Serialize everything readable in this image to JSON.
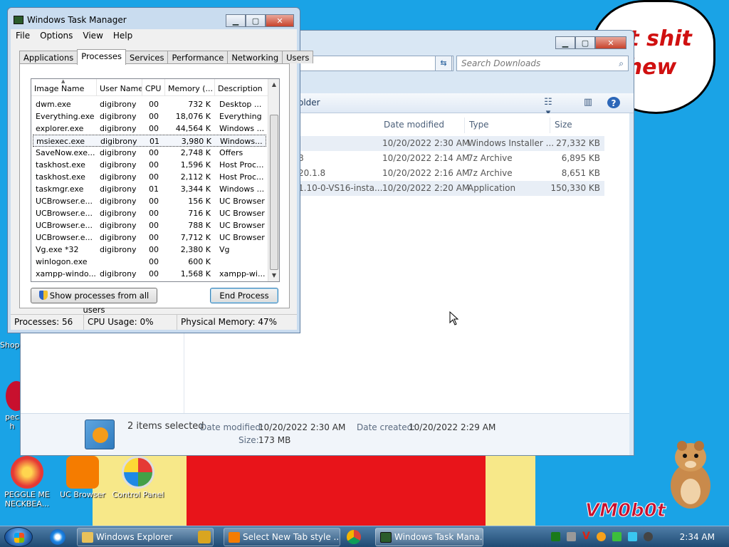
{
  "wallpaper": {
    "bubble_line1": "at shit",
    "bubble_line2": "chew",
    "signature": "VM0b0t"
  },
  "desktop_icons": [
    {
      "label": "Shop",
      "color": "#ffffff"
    },
    {
      "label": "pec\nh",
      "color": "#c8102e"
    },
    {
      "label": "PEGGLE ME NECKBEA...",
      "color": "#e53935"
    },
    {
      "label": "UC Browser",
      "color": "#f57c00"
    },
    {
      "label": "Control Panel",
      "color": "#cfcfcf"
    }
  ],
  "explorer": {
    "search_placeholder": "Search Downloads",
    "toolbar_folder_label": "older",
    "columns": [
      "Date modified",
      "Type",
      "Size"
    ],
    "files": [
      {
        "name": "",
        "date": "10/20/2022 2:30 AM",
        "type": "Windows Installer ...",
        "size": "27,332 KB",
        "selected": true
      },
      {
        "name": "8",
        "date": "10/20/2022 2:14 AM",
        "type": "7z Archive",
        "size": "6,895 KB",
        "selected": false
      },
      {
        "name": "20.1.8",
        "date": "10/20/2022 2:16 AM",
        "type": "7z Archive",
        "size": "8,651 KB",
        "selected": false
      },
      {
        "name": "1.10-0-VS16-insta...",
        "date": "10/20/2022 2:20 AM",
        "type": "Application",
        "size": "150,330 KB",
        "selected": true
      }
    ],
    "details": {
      "selection": "2 items selected",
      "modified_label": "Date modified:",
      "modified_value": "10/20/2022 2:30 AM",
      "created_label": "Date created:",
      "created_value": "10/20/2022 2:29 AM",
      "size_label": "Size:",
      "size_value": "173 MB"
    }
  },
  "taskmgr": {
    "title": "Windows Task Manager",
    "menu": [
      "File",
      "Options",
      "View",
      "Help"
    ],
    "tabs": [
      "Applications",
      "Processes",
      "Services",
      "Performance",
      "Networking",
      "Users"
    ],
    "active_tab": "Processes",
    "columns": [
      "Image Name",
      "User Name",
      "CPU",
      "Memory (...",
      "Description"
    ],
    "processes": [
      {
        "image": "dwm.exe",
        "user": "digibrony",
        "cpu": "00",
        "mem": "732 K",
        "desc": "Desktop ..."
      },
      {
        "image": "Everything.exe",
        "user": "digibrony",
        "cpu": "00",
        "mem": "18,076 K",
        "desc": "Everything"
      },
      {
        "image": "explorer.exe",
        "user": "digibrony",
        "cpu": "00",
        "mem": "44,564 K",
        "desc": "Windows ..."
      },
      {
        "image": "msiexec.exe",
        "user": "digibrony",
        "cpu": "01",
        "mem": "3,980 K",
        "desc": "Windows..."
      },
      {
        "image": "SaveNow.exe...",
        "user": "digibrony",
        "cpu": "00",
        "mem": "2,748 K",
        "desc": "Offers"
      },
      {
        "image": "taskhost.exe",
        "user": "digibrony",
        "cpu": "00",
        "mem": "1,596 K",
        "desc": "Host Proc..."
      },
      {
        "image": "taskhost.exe",
        "user": "digibrony",
        "cpu": "00",
        "mem": "2,112 K",
        "desc": "Host Proc..."
      },
      {
        "image": "taskmgr.exe",
        "user": "digibrony",
        "cpu": "01",
        "mem": "3,344 K",
        "desc": "Windows ..."
      },
      {
        "image": "UCBrowser.e...",
        "user": "digibrony",
        "cpu": "00",
        "mem": "156 K",
        "desc": "UC Browser"
      },
      {
        "image": "UCBrowser.e...",
        "user": "digibrony",
        "cpu": "00",
        "mem": "716 K",
        "desc": "UC Browser"
      },
      {
        "image": "UCBrowser.e...",
        "user": "digibrony",
        "cpu": "00",
        "mem": "788 K",
        "desc": "UC Browser"
      },
      {
        "image": "UCBrowser.e...",
        "user": "digibrony",
        "cpu": "00",
        "mem": "7,712 K",
        "desc": "UC Browser"
      },
      {
        "image": "Vg.exe *32",
        "user": "digibrony",
        "cpu": "00",
        "mem": "2,380 K",
        "desc": "Vg"
      },
      {
        "image": "winlogon.exe",
        "user": "",
        "cpu": "00",
        "mem": "600 K",
        "desc": ""
      },
      {
        "image": "xampp-windo...",
        "user": "digibrony",
        "cpu": "00",
        "mem": "1,568 K",
        "desc": "xampp-wi..."
      }
    ],
    "selected_index": 3,
    "show_all_label": "Show processes from all users",
    "end_process_label": "End Process",
    "status": {
      "processes": "Processes: 56",
      "cpu": "CPU Usage: 0%",
      "memory": "Physical Memory: 47%"
    }
  },
  "taskbar": {
    "buttons": [
      {
        "label": "Windows Explorer",
        "icon_color": "#e8c15a"
      },
      {
        "label": "Select New Tab style ...",
        "icon_color": "#f57c00"
      },
      {
        "label": "Windows Task Mana...",
        "icon_color": "#2b5c2b"
      }
    ],
    "clock": "2:34 AM"
  }
}
